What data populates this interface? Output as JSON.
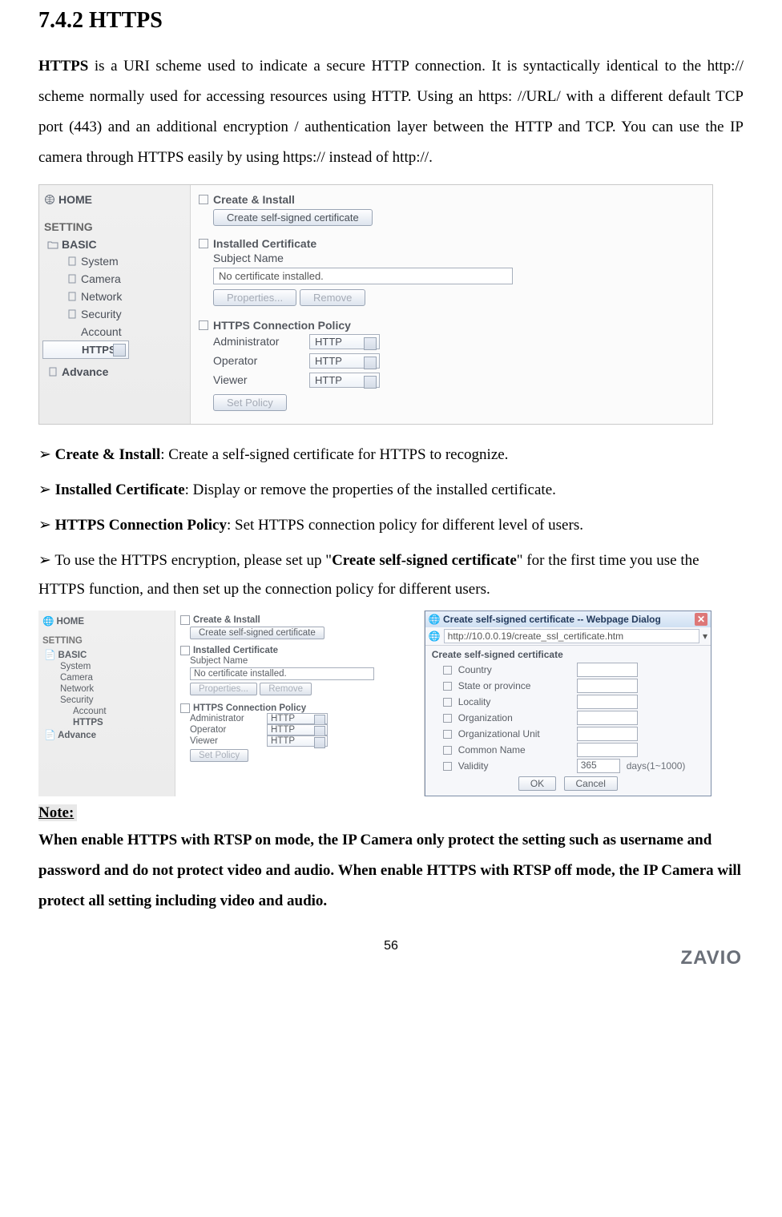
{
  "doc": {
    "section_title": "7.4.2 HTTPS",
    "https_bold": "HTTPS",
    "intro_rest": " is a URI scheme used to indicate a secure HTTP connection. It is syntactically identical to the http:// scheme normally used for accessing resources using HTTP. Using an https: //URL/ with a different default TCP port (443) and an additional encryption / authentication layer between the HTTP and TCP. You can use the IP camera through HTTPS easily by using https:// instead of http://.",
    "b1_arrow": "➢ ",
    "b1_bold": "Create & Install",
    "b1_rest": ": Create a self-signed certificate for HTTPS to recognize.",
    "b2_bold": "Installed Certificate",
    "b2_rest": ": Display or remove the properties of the installed certificate.",
    "b3_bold": "HTTPS Connection Policy",
    "b3_rest": ": Set HTTPS connection policy for different level of users.",
    "b4_pre": "To use the HTTPS encryption, please set up \"",
    "b4_bold": "Create self-signed certificate",
    "b4_post": "\" for the first time you use the HTTPS function, and then set up the connection policy for different users.",
    "note_label": "Note:  ",
    "note_body": "When enable HTTPS with RTSP on mode, the IP Camera only protect the setting such as username and password and do not protect video and audio. When enable HTTPS with RTSP off mode, the IP Camera will protect all setting including video and audio.",
    "page_number": "56",
    "logo": "ZAVIO"
  },
  "nav": {
    "home": "HOME",
    "setting": "SETTING",
    "basic": "BASIC",
    "items": {
      "system": "System",
      "camera": "Camera",
      "network": "Network",
      "security": "Security",
      "account": "Account",
      "https": "HTTPS"
    },
    "advance": "Advance"
  },
  "panel1": {
    "create_install": "Create & Install",
    "create_btn": "Create self-signed certificate",
    "installed": "Installed Certificate",
    "subject_name": "Subject Name",
    "no_cert": "No certificate installed.",
    "properties": "Properties...",
    "remove": "Remove",
    "policy": "HTTPS Connection Policy",
    "admin": "Administrator",
    "operator": "Operator",
    "viewer": "Viewer",
    "http": "HTTP",
    "set_policy": "Set Policy"
  },
  "dialog": {
    "title": "Create self-signed certificate -- Webpage Dialog",
    "url": "http://10.0.0.19/create_ssl_certificate.htm",
    "header": "Create self-signed certificate",
    "fields": {
      "country": "Country",
      "state": "State or province",
      "locality": "Locality",
      "organization": "Organization",
      "org_unit": "Organizational Unit",
      "common_name": "Common Name",
      "validity": "Validity"
    },
    "validity_value": "365",
    "validity_unit": "days(1~1000)",
    "ok": "OK",
    "cancel": "Cancel"
  }
}
